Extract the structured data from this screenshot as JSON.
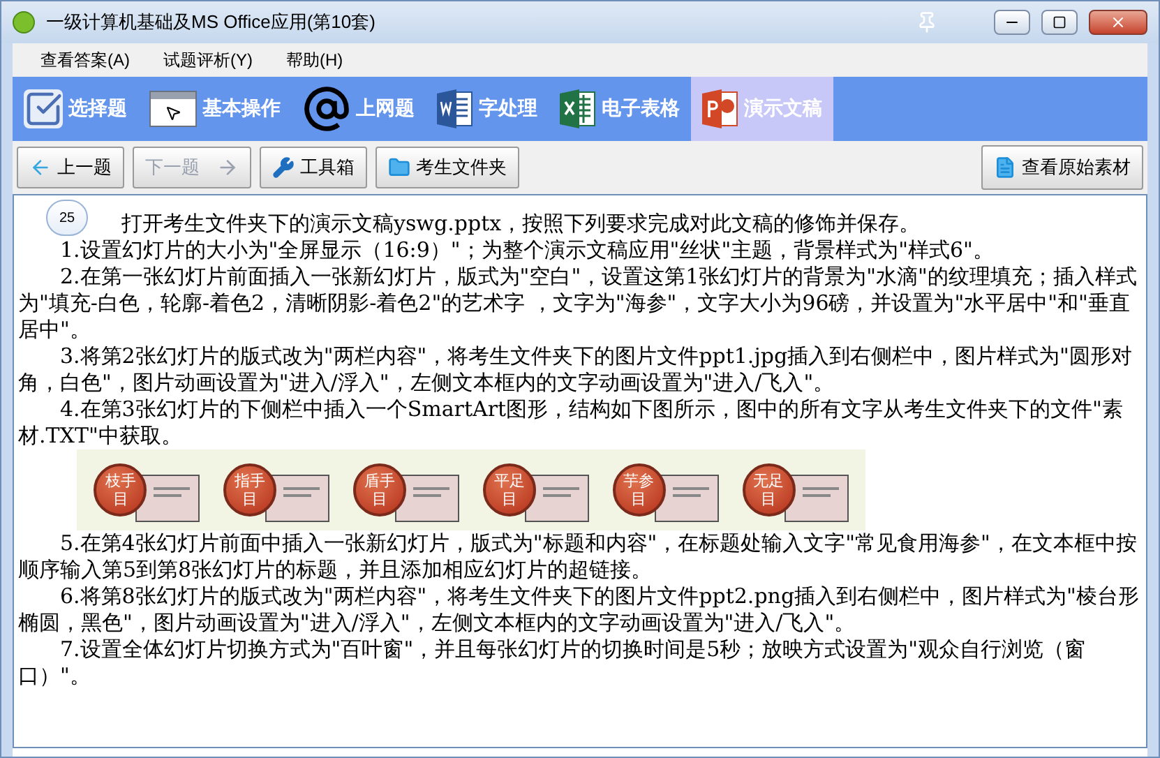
{
  "window": {
    "title": "一级计算机基础及MS Office应用(第10套)"
  },
  "menu": [
    "查看答案(A)",
    "试题评析(Y)",
    "帮助(H)"
  ],
  "tabs": [
    {
      "label": "选择题",
      "kind": "choice",
      "selected": false
    },
    {
      "label": "基本操作",
      "kind": "basic",
      "selected": false
    },
    {
      "label": "上网题",
      "kind": "web",
      "selected": false
    },
    {
      "label": "字处理",
      "kind": "word",
      "selected": false
    },
    {
      "label": "电子表格",
      "kind": "excel",
      "selected": false
    },
    {
      "label": "演示文稿",
      "kind": "ppt",
      "selected": true
    }
  ],
  "toolbar": [
    {
      "label": "上一题",
      "kind": "prev",
      "disabled": false
    },
    {
      "label": "下一题",
      "kind": "next",
      "disabled": true
    },
    {
      "label": "工具箱",
      "kind": "tools",
      "disabled": false
    },
    {
      "label": "考生文件夹",
      "kind": "folder",
      "disabled": false
    }
  ],
  "view_source_button": "查看原始素材",
  "question": {
    "number": "25",
    "intro": "打开考生文件夹下的演示文稿yswg.pptx，按照下列要求完成对此文稿的修饰并保存。",
    "steps_before": [
      "1.设置幻灯片的大小为\"全屏显示（16:9）\"；为整个演示文稿应用\"丝状\"主题，背景样式为\"样式6\"。",
      "2.在第一张幻灯片前面插入一张新幻灯片，版式为\"空白\"，设置这第1张幻灯片的背景为\"水滴\"的纹理填充；插入样式为\"填充-白色，轮廓-着色2，清晰阴影-着色2\"的艺术字 ，文字为\"海参\"，文字大小为96磅，并设置为\"水平居中\"和\"垂直居中\"。",
      "3.将第2张幻灯片的版式改为\"两栏内容\"，将考生文件夹下的图片文件ppt1.jpg插入到右侧栏中，图片样式为\"圆形对角，白色\"，图片动画设置为\"进入/浮入\"，左侧文本框内的文字动画设置为\"进入/飞入\"。",
      "4.在第3张幻灯片的下侧栏中插入一个SmartArt图形，结构如下图所示，图中的所有文字从考生文件夹下的文件\"素材.TXT\"中获取。"
    ],
    "figure_items": [
      "枝手目",
      "指手目",
      "盾手目",
      "平足目",
      "芋参目",
      "无足目"
    ],
    "steps_after": [
      "5.在第4张幻灯片前面中插入一张新幻灯片，版式为\"标题和内容\"，在标题处输入文字\"常见食用海参\"，在文本框中按顺序输入第5到第8张幻灯片的标题，并且添加相应幻灯片的超链接。",
      "6.将第8张幻灯片的版式改为\"两栏内容\"，将考生文件夹下的图片文件ppt2.png插入到右侧栏中，图片样式为\"棱台形椭圆，黑色\"，图片动画设置为\"进入/浮入\"，左侧文本框内的文字动画设置为\"进入/飞入\"。",
      "7.设置全体幻灯片切换方式为\"百叶窗\"，并且每张幻灯片的切换时间是5秒；放映方式设置为\"观众自行浏览（窗口）\"。"
    ]
  }
}
